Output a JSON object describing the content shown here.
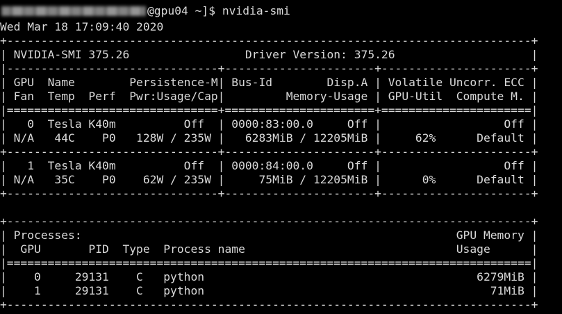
{
  "prompt": {
    "user_host_suffix": "@gpu04 ~]$ ",
    "command": "nvidia-smi"
  },
  "timestamp": "Wed Mar 18 17:09:40 2020",
  "table": {
    "lines": [
      "+-----------------------------------------------------------------------------+",
      "| NVIDIA-SMI 375.26                 Driver Version: 375.26                    |",
      "|-------------------------------+----------------------+----------------------+",
      "| GPU  Name        Persistence-M| Bus-Id        Disp.A | Volatile Uncorr. ECC |",
      "| Fan  Temp  Perf  Pwr:Usage/Cap|         Memory-Usage | GPU-Util  Compute M. |",
      "|===============================+======================+======================|",
      "|   0  Tesla K40m          Off  | 0000:83:00.0     Off |                  Off |",
      "| N/A   44C    P0   128W / 235W |   6283MiB / 12205MiB |     62%      Default |",
      "+-------------------------------+----------------------+----------------------+",
      "|   1  Tesla K40m          Off  | 0000:84:00.0     Off |                  Off |",
      "| N/A   35C    P0    62W / 235W |     75MiB / 12205MiB |      0%      Default |",
      "+-------------------------------+----------------------+----------------------+",
      "",
      "+-----------------------------------------------------------------------------+",
      "| Processes:                                                       GPU Memory |",
      "|  GPU       PID  Type  Process name                               Usage      |",
      "|=============================================================================|",
      "|    0     29131    C   python                                        6279MiB |",
      "|    1     29131    C   python                                          71MiB |",
      "+-----------------------------------------------------------------------------+"
    ]
  }
}
